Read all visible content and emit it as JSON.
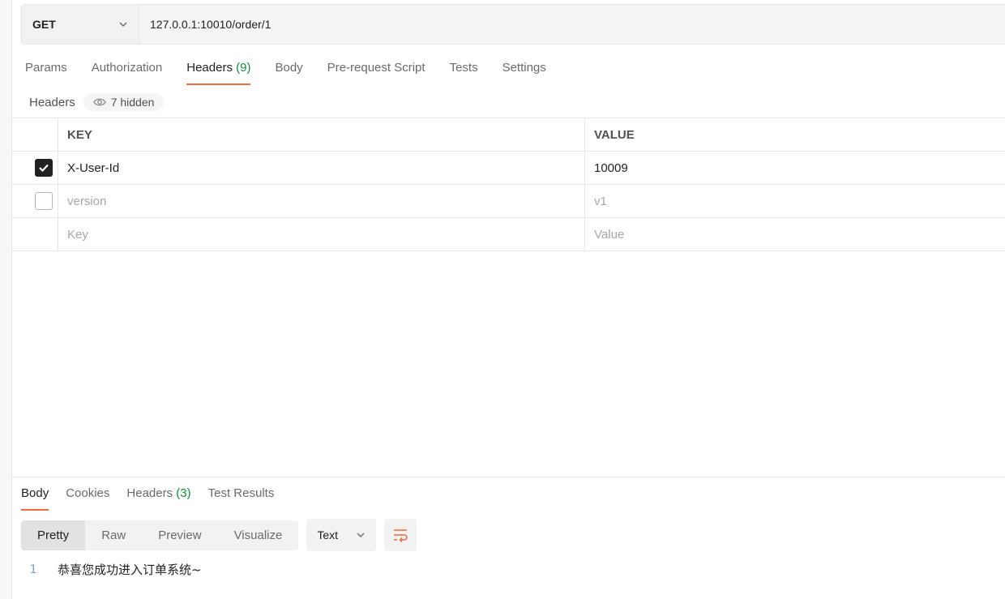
{
  "request": {
    "method": "GET",
    "url": "127.0.0.1:10010/order/1"
  },
  "request_tabs": [
    {
      "label": "Params"
    },
    {
      "label": "Authorization"
    },
    {
      "label": "Headers",
      "count": "(9)"
    },
    {
      "label": "Body"
    },
    {
      "label": "Pre-request Script"
    },
    {
      "label": "Tests"
    },
    {
      "label": "Settings"
    }
  ],
  "active_request_tab": "Headers",
  "headers_section": {
    "title": "Headers",
    "hidden_label": "7 hidden",
    "columns": {
      "key": "KEY",
      "value": "VALUE"
    },
    "rows": [
      {
        "checked": true,
        "key": "X-User-Id",
        "value": "10009"
      },
      {
        "checked": false,
        "key": "version",
        "value": "v1"
      }
    ],
    "placeholder": {
      "key": "Key",
      "value": "Value"
    }
  },
  "response_tabs": [
    {
      "label": "Body"
    },
    {
      "label": "Cookies"
    },
    {
      "label": "Headers",
      "count": "(3)"
    },
    {
      "label": "Test Results"
    }
  ],
  "active_response_tab": "Body",
  "response_view": {
    "modes": [
      "Pretty",
      "Raw",
      "Preview",
      "Visualize"
    ],
    "active_mode": "Pretty",
    "format": "Text"
  },
  "response_body": {
    "lines": [
      {
        "number": "1",
        "text": "恭喜您成功进入订单系统~"
      }
    ]
  },
  "colors": {
    "accent": "#f26b3a",
    "count_green": "#0a8f3e",
    "line_number": "#7a9cc6"
  },
  "icons": {
    "method_dropdown": "chevron-down-icon",
    "hidden_toggle": "eye-icon",
    "checkbox": "check-icon",
    "format_dropdown": "chevron-down-icon",
    "wrap": "wrap-lines-icon"
  }
}
